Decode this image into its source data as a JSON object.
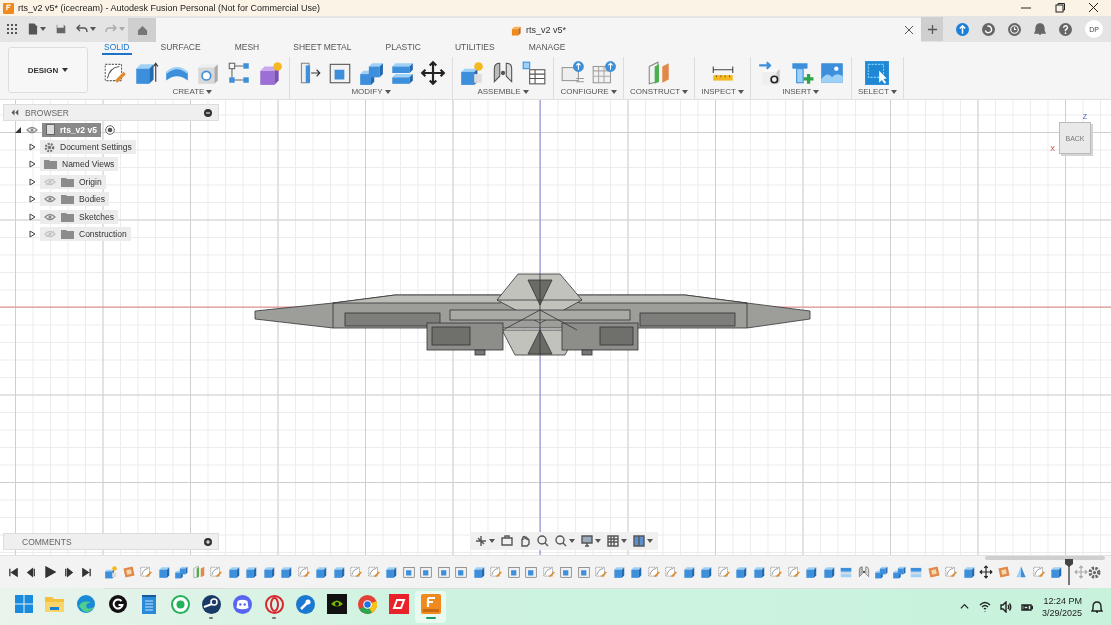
{
  "window": {
    "title": "rts_v2 v5* (icecream) - Autodesk Fusion Personal (Not for Commercial Use)"
  },
  "document_tab": {
    "label": "rts_v2 v5*"
  },
  "account": {
    "initials": "DP"
  },
  "workspace": {
    "label": "DESIGN"
  },
  "toolbar_tabs": [
    {
      "label": "SOLID",
      "selected": true
    },
    {
      "label": "SURFACE",
      "selected": false
    },
    {
      "label": "MESH",
      "selected": false
    },
    {
      "label": "SHEET METAL",
      "selected": false
    },
    {
      "label": "PLASTIC",
      "selected": false
    },
    {
      "label": "UTILITIES",
      "selected": false
    },
    {
      "label": "MANAGE",
      "selected": false
    }
  ],
  "tool_groups": [
    {
      "label": "CREATE",
      "tools": [
        {
          "kind": "sketch"
        },
        {
          "kind": "extrude"
        },
        {
          "kind": "revolve"
        },
        {
          "kind": "hole"
        },
        {
          "kind": "pattern"
        },
        {
          "kind": "form"
        }
      ]
    },
    {
      "label": "MODIFY",
      "tools": [
        {
          "kind": "presspull"
        },
        {
          "kind": "shell"
        },
        {
          "kind": "combine"
        },
        {
          "kind": "offset"
        },
        {
          "kind": "move"
        }
      ]
    },
    {
      "label": "ASSEMBLE",
      "tools": [
        {
          "kind": "component"
        },
        {
          "kind": "joint"
        },
        {
          "kind": "table"
        }
      ]
    },
    {
      "label": "CONFIGURE",
      "tools": [
        {
          "kind": "configure"
        },
        {
          "kind": "configtable"
        }
      ]
    },
    {
      "label": "CONSTRUCT",
      "tools": [
        {
          "kind": "plane"
        }
      ]
    },
    {
      "label": "INSPECT",
      "tools": [
        {
          "kind": "measure"
        }
      ]
    },
    {
      "label": "INSERT",
      "tools": [
        {
          "kind": "derive"
        },
        {
          "kind": "bolt"
        },
        {
          "kind": "image"
        }
      ]
    },
    {
      "label": "SELECT",
      "tools": [
        {
          "kind": "select"
        }
      ]
    }
  ],
  "browser": {
    "title": "BROWSER",
    "root": {
      "label": "rts_v2 v5",
      "visible": true,
      "expanded": true,
      "selected": true,
      "children": [
        {
          "label": "Document Settings",
          "kind": "settings",
          "expanded": false,
          "selected": false
        },
        {
          "label": "Named Views",
          "kind": "folder",
          "expanded": false,
          "selected": false
        },
        {
          "label": "Origin",
          "kind": "folder",
          "visible": false,
          "expanded": false,
          "selected": false
        },
        {
          "label": "Bodies",
          "kind": "folder",
          "visible": true,
          "expanded": false,
          "selected": false
        },
        {
          "label": "Sketches",
          "kind": "folder",
          "visible": true,
          "expanded": false,
          "selected": false
        },
        {
          "label": "Construction",
          "kind": "folder",
          "visible": false,
          "expanded": false,
          "selected": false
        }
      ]
    }
  },
  "comments": {
    "title": "COMMENTS"
  },
  "view_cube": {
    "face": "BACK",
    "z": "Z",
    "x": "X"
  },
  "timeline": {
    "features": [
      {
        "kind": "component",
        "active": true
      },
      {
        "kind": "box",
        "active": true
      },
      {
        "kind": "sketch",
        "active": true
      },
      {
        "kind": "body",
        "active": true
      },
      {
        "kind": "combine",
        "active": true
      },
      {
        "kind": "plane",
        "active": true
      },
      {
        "kind": "sketch",
        "active": true
      },
      {
        "kind": "body",
        "active": true
      },
      {
        "kind": "body",
        "active": true
      },
      {
        "kind": "body",
        "active": true
      },
      {
        "kind": "body",
        "active": true
      },
      {
        "kind": "sketch",
        "active": true
      },
      {
        "kind": "body",
        "active": true
      },
      {
        "kind": "body",
        "active": true
      },
      {
        "kind": "sketch",
        "active": true
      },
      {
        "kind": "sketch",
        "active": true
      },
      {
        "kind": "body",
        "active": true
      },
      {
        "kind": "shell",
        "active": true
      },
      {
        "kind": "shell",
        "active": true
      },
      {
        "kind": "shell",
        "active": true
      },
      {
        "kind": "shell",
        "active": true
      },
      {
        "kind": "body",
        "active": true
      },
      {
        "kind": "sketch",
        "active": true
      },
      {
        "kind": "shell",
        "active": true
      },
      {
        "kind": "shell",
        "active": true
      },
      {
        "kind": "sketch",
        "active": true
      },
      {
        "kind": "shell",
        "active": true
      },
      {
        "kind": "shell",
        "active": true
      },
      {
        "kind": "sketch",
        "active": true
      },
      {
        "kind": "body",
        "active": true
      },
      {
        "kind": "body",
        "active": true
      },
      {
        "kind": "sketch",
        "active": true
      },
      {
        "kind": "sketch",
        "active": true
      },
      {
        "kind": "body",
        "active": true
      },
      {
        "kind": "body",
        "active": true
      },
      {
        "kind": "sketch",
        "active": true
      },
      {
        "kind": "body",
        "active": true
      },
      {
        "kind": "body",
        "active": true
      },
      {
        "kind": "sketch",
        "active": true
      },
      {
        "kind": "sketch",
        "active": true
      },
      {
        "kind": "body",
        "active": true
      },
      {
        "kind": "body",
        "active": true
      },
      {
        "kind": "split",
        "active": true
      },
      {
        "kind": "joint",
        "active": true
      },
      {
        "kind": "combine",
        "active": true
      },
      {
        "kind": "combine",
        "active": true
      },
      {
        "kind": "split",
        "active": true
      },
      {
        "kind": "box",
        "active": true
      },
      {
        "kind": "sketch",
        "active": true
      },
      {
        "kind": "body",
        "active": true
      },
      {
        "kind": "move",
        "active": true
      },
      {
        "kind": "box",
        "active": true
      },
      {
        "kind": "mirror",
        "active": true
      },
      {
        "kind": "sketch",
        "active": true
      },
      {
        "kind": "body",
        "active": true
      },
      {
        "kind": "move",
        "active": false
      }
    ]
  },
  "taskbar": {
    "apps": [
      {
        "kind": "windows",
        "running": false,
        "selected": false
      },
      {
        "kind": "files",
        "running": false,
        "selected": false
      },
      {
        "kind": "edge",
        "running": false,
        "selected": false
      },
      {
        "kind": "ghub",
        "running": false,
        "selected": false
      },
      {
        "kind": "notepad",
        "running": false,
        "selected": false
      },
      {
        "kind": "whatsapp",
        "running": false,
        "selected": false
      },
      {
        "kind": "steam",
        "running": true,
        "selected": false
      },
      {
        "kind": "discord",
        "running": false,
        "selected": false
      },
      {
        "kind": "opera",
        "running": true,
        "selected": false
      },
      {
        "kind": "wrench",
        "running": false,
        "selected": false
      },
      {
        "kind": "nvidia",
        "running": false,
        "selected": false
      },
      {
        "kind": "chrome",
        "running": false,
        "selected": false
      },
      {
        "kind": "dash",
        "running": false,
        "selected": false
      },
      {
        "kind": "fusion",
        "running": true,
        "selected": true
      }
    ],
    "clock": {
      "time": "12:24 PM",
      "date": "3/29/2025"
    }
  }
}
